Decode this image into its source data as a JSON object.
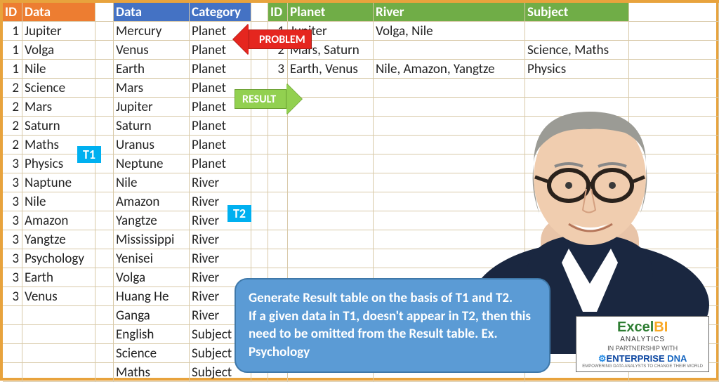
{
  "headers": {
    "t1": {
      "id": "ID",
      "data": "Data"
    },
    "t2": {
      "data": "Data",
      "category": "Category"
    },
    "t3": {
      "id": "ID",
      "planet": "Planet",
      "river": "River",
      "subject": "Subject"
    }
  },
  "t1": [
    {
      "id": "1",
      "data": "Jupiter"
    },
    {
      "id": "1",
      "data": "Volga"
    },
    {
      "id": "1",
      "data": "Nile"
    },
    {
      "id": "2",
      "data": "Science"
    },
    {
      "id": "2",
      "data": "Mars"
    },
    {
      "id": "2",
      "data": "Saturn"
    },
    {
      "id": "2",
      "data": "Maths"
    },
    {
      "id": "3",
      "data": "Physics"
    },
    {
      "id": "3",
      "data": "Naptune"
    },
    {
      "id": "3",
      "data": "Nile"
    },
    {
      "id": "3",
      "data": "Amazon"
    },
    {
      "id": "3",
      "data": "Yangtze"
    },
    {
      "id": "3",
      "data": "Psychology"
    },
    {
      "id": "3",
      "data": "Earth"
    },
    {
      "id": "3",
      "data": "Venus"
    }
  ],
  "t2": [
    {
      "data": "Mercury",
      "cat": "Planet"
    },
    {
      "data": "Venus",
      "cat": "Planet"
    },
    {
      "data": "Earth",
      "cat": "Planet"
    },
    {
      "data": "Mars",
      "cat": "Planet"
    },
    {
      "data": "Jupiter",
      "cat": "Planet"
    },
    {
      "data": "Saturn",
      "cat": "Planet"
    },
    {
      "data": "Uranus",
      "cat": "Planet"
    },
    {
      "data": "Neptune",
      "cat": "Planet"
    },
    {
      "data": "Nile",
      "cat": "River"
    },
    {
      "data": "Amazon",
      "cat": "River"
    },
    {
      "data": "Yangtze",
      "cat": "River"
    },
    {
      "data": "Mississippi",
      "cat": "River"
    },
    {
      "data": "Yenisei",
      "cat": "River"
    },
    {
      "data": "Volga",
      "cat": "River"
    },
    {
      "data": "Huang He",
      "cat": "River"
    },
    {
      "data": "Ganga",
      "cat": "River"
    },
    {
      "data": "English",
      "cat": "Subject"
    },
    {
      "data": "Science",
      "cat": "Subject"
    },
    {
      "data": "Maths",
      "cat": "Subject"
    }
  ],
  "t3": [
    {
      "id": "1",
      "planet": "Jupiter",
      "river": "Volga, Nile",
      "subject": ""
    },
    {
      "id": "2",
      "planet": "Mars, Saturn",
      "river": "",
      "subject": "Science, Maths"
    },
    {
      "id": "3",
      "planet": "Earth, Venus",
      "river": "Nile, Amazon, Yangtze",
      "subject": "Physics"
    }
  ],
  "badges": {
    "t1": "T1",
    "t2": "T2"
  },
  "arrows": {
    "problem": "PROBLEM",
    "result": "RESULT"
  },
  "bubble": "Generate Result table on the basis of T1 and T2.\nIf a given data in T1, doesn't appear in T2, then this need to be omitted from the Result table. Ex. Psychology",
  "logo": {
    "line1a": "Excel",
    "line1b": "BI",
    "line2": "ANALYTICS",
    "line3": "IN PARTNERSHIP WITH",
    "line4a": "ENTERPRISE ",
    "line4b": "DNA",
    "line5": "EMPOWERING DATA ANALYSTS TO CHANGE THEIR WORLD"
  }
}
